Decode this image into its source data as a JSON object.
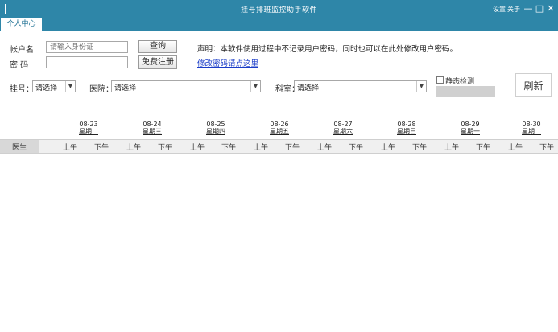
{
  "window": {
    "title": "挂号排班监控助手软件",
    "settings_link": "设置",
    "about_link": "关于",
    "minimize": "—",
    "maximize": "□",
    "close": "✕"
  },
  "tabs": [
    {
      "label": "个人中心"
    }
  ],
  "login": {
    "account_label": "帐户名",
    "account_placeholder": "请输入身份证",
    "password_label": "密 码",
    "password_value": "",
    "query_button": "查询",
    "register_button": "免费注册"
  },
  "notice": {
    "text": "声明：本软件使用过程中不记录用户密码，同时也可以在此处修改用户密码。",
    "link_text": "修改密码请点这里"
  },
  "filters": {
    "hospital_label": "挂号：",
    "hospital_value": "请选择",
    "department_label": "医院：",
    "department_value": "请选择",
    "doctor_label": "科室：",
    "doctor_value": "请选择",
    "checkbox_label": "静态检测",
    "refresh_button": "刷新"
  },
  "schedule": {
    "first_col": "医生",
    "days": [
      {
        "date": "08-23",
        "weekday": "星期二"
      },
      {
        "date": "08-24",
        "weekday": "星期三"
      },
      {
        "date": "08-25",
        "weekday": "星期四"
      },
      {
        "date": "08-26",
        "weekday": "星期五"
      },
      {
        "date": "08-27",
        "weekday": "星期六"
      },
      {
        "date": "08-28",
        "weekday": "星期日"
      },
      {
        "date": "08-29",
        "weekday": "星期一"
      },
      {
        "date": "08-30",
        "weekday": "星期二"
      }
    ],
    "am_label": "上午",
    "pm_label": "下午"
  }
}
